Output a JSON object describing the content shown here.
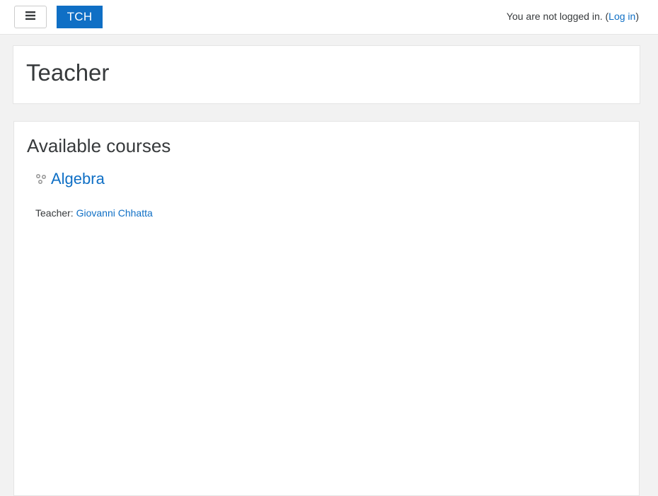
{
  "navbar": {
    "toggle_icon": "hamburger-icon",
    "brand": "TCH",
    "login": {
      "prefix": "You are not logged in. (",
      "link": "Log in",
      "suffix": ")"
    }
  },
  "header": {
    "title": "Teacher"
  },
  "main": {
    "section_title": "Available courses",
    "courses": [
      {
        "icon": "course-icon",
        "name": "Algebra",
        "teacher_label": "Teacher: ",
        "teacher_name": "Giovanni Chhatta"
      }
    ]
  },
  "colors": {
    "accent": "#0f6fc5",
    "background": "#f2f2f2",
    "text": "#373a3c"
  }
}
